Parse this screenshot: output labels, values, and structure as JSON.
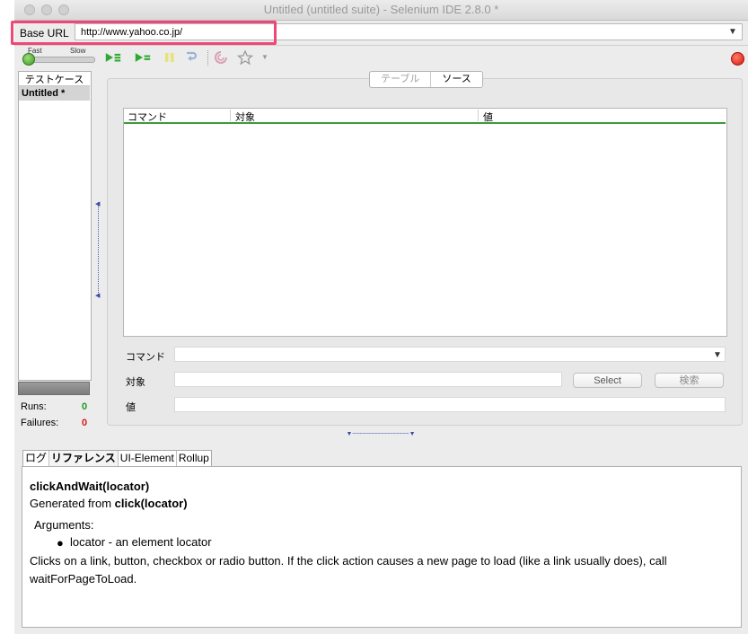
{
  "window": {
    "title": "Untitled (untitled suite) - Selenium IDE 2.8.0 *"
  },
  "base_url": {
    "label": "Base URL",
    "value": "http://www.yahoo.co.jp/"
  },
  "toolbar": {
    "speed_fast": "Fast",
    "speed_slow": "Slow",
    "speed_level": 0,
    "buttons": [
      "play-suite",
      "play-test",
      "pause",
      "step",
      "rollup",
      "favorite"
    ]
  },
  "testcases": {
    "header": "テストケース",
    "items": [
      "Untitled *"
    ]
  },
  "stats": {
    "runs_label": "Runs:",
    "runs_value": "0",
    "failures_label": "Failures:",
    "failures_value": "0"
  },
  "editor": {
    "tabs": [
      "テーブル",
      "ソース"
    ],
    "active_tab": "ソース",
    "columns": [
      "コマンド",
      "対象",
      "値"
    ],
    "command_label": "コマンド",
    "command_value": "",
    "target_label": "対象",
    "target_value": "",
    "value_label": "値",
    "value_value": "",
    "select_button": "Select",
    "find_button": "検索"
  },
  "bottom": {
    "tabs": [
      "ログ",
      "リファレンス",
      "UI-Element",
      "Rollup"
    ],
    "active_tab": "リファレンス",
    "ref_title": "clickAndWait(locator)",
    "ref_generated_prefix": "Generated from ",
    "ref_generated_cmd": "click(locator)",
    "ref_arguments_heading": "Arguments:",
    "ref_arguments": [
      "locator - an element locator"
    ],
    "ref_description": "Clicks on a link, button, checkbox or radio button. If the click action causes a new page to load (like a link usually does), call waitForPageToLoad."
  },
  "colors": {
    "highlight": "#f0467a",
    "play_green": "#2ea82e",
    "record_red": "#d8150b",
    "runs_green": "#1e9a1e",
    "failures_red": "#d41a1a"
  }
}
